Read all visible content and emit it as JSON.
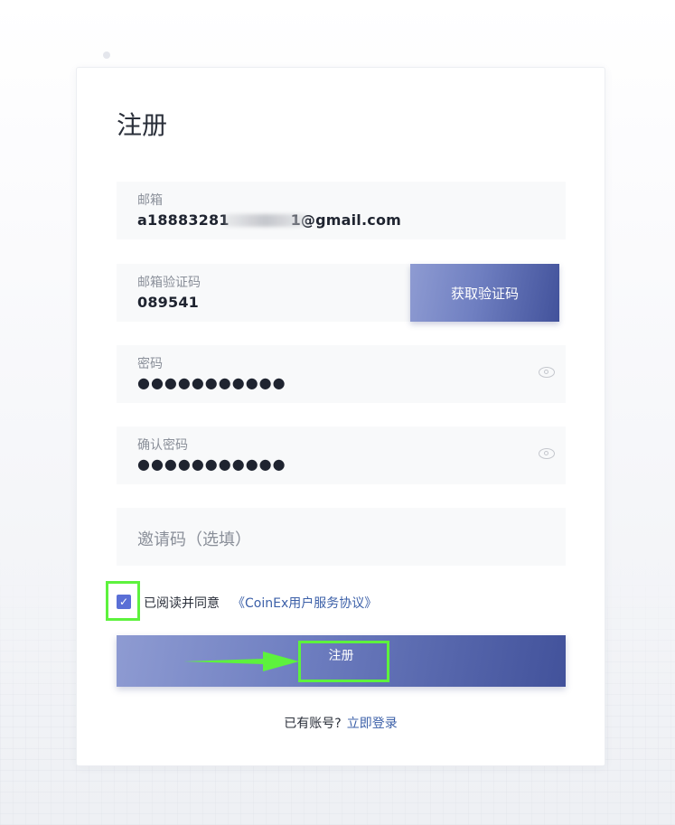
{
  "form": {
    "title": "注册",
    "email": {
      "label": "邮箱",
      "value": "a18883281                    1@gmail.com"
    },
    "email_code": {
      "label": "邮箱验证码",
      "value": "089541",
      "button_label": "获取验证码"
    },
    "password": {
      "label": "密码",
      "value": "●●●●●●●●●●●"
    },
    "confirm_password": {
      "label": "确认密码",
      "value": "●●●●●●●●●●●"
    },
    "invite_code": {
      "placeholder": "邀请码（选填）"
    },
    "agreement": {
      "checked": true,
      "text": "已阅读并同意",
      "link_label": "《CoinEx用户服务协议》"
    },
    "submit_label": "注册",
    "login_prompt": "已有账号?",
    "login_link_label": "立即登录"
  },
  "colors": {
    "accent_link": "#3c60a8",
    "button_gradient_start": "#8e9bd2",
    "button_gradient_end": "#42529b",
    "annotation": "#5df23d",
    "checkbox": "#5a6fd6"
  },
  "icons": {
    "password_toggle": "eye-icon",
    "confirm_password_toggle": "eye-icon",
    "checkbox_mark": "check-icon",
    "annotation_arrow": "arrow-right-icon"
  }
}
